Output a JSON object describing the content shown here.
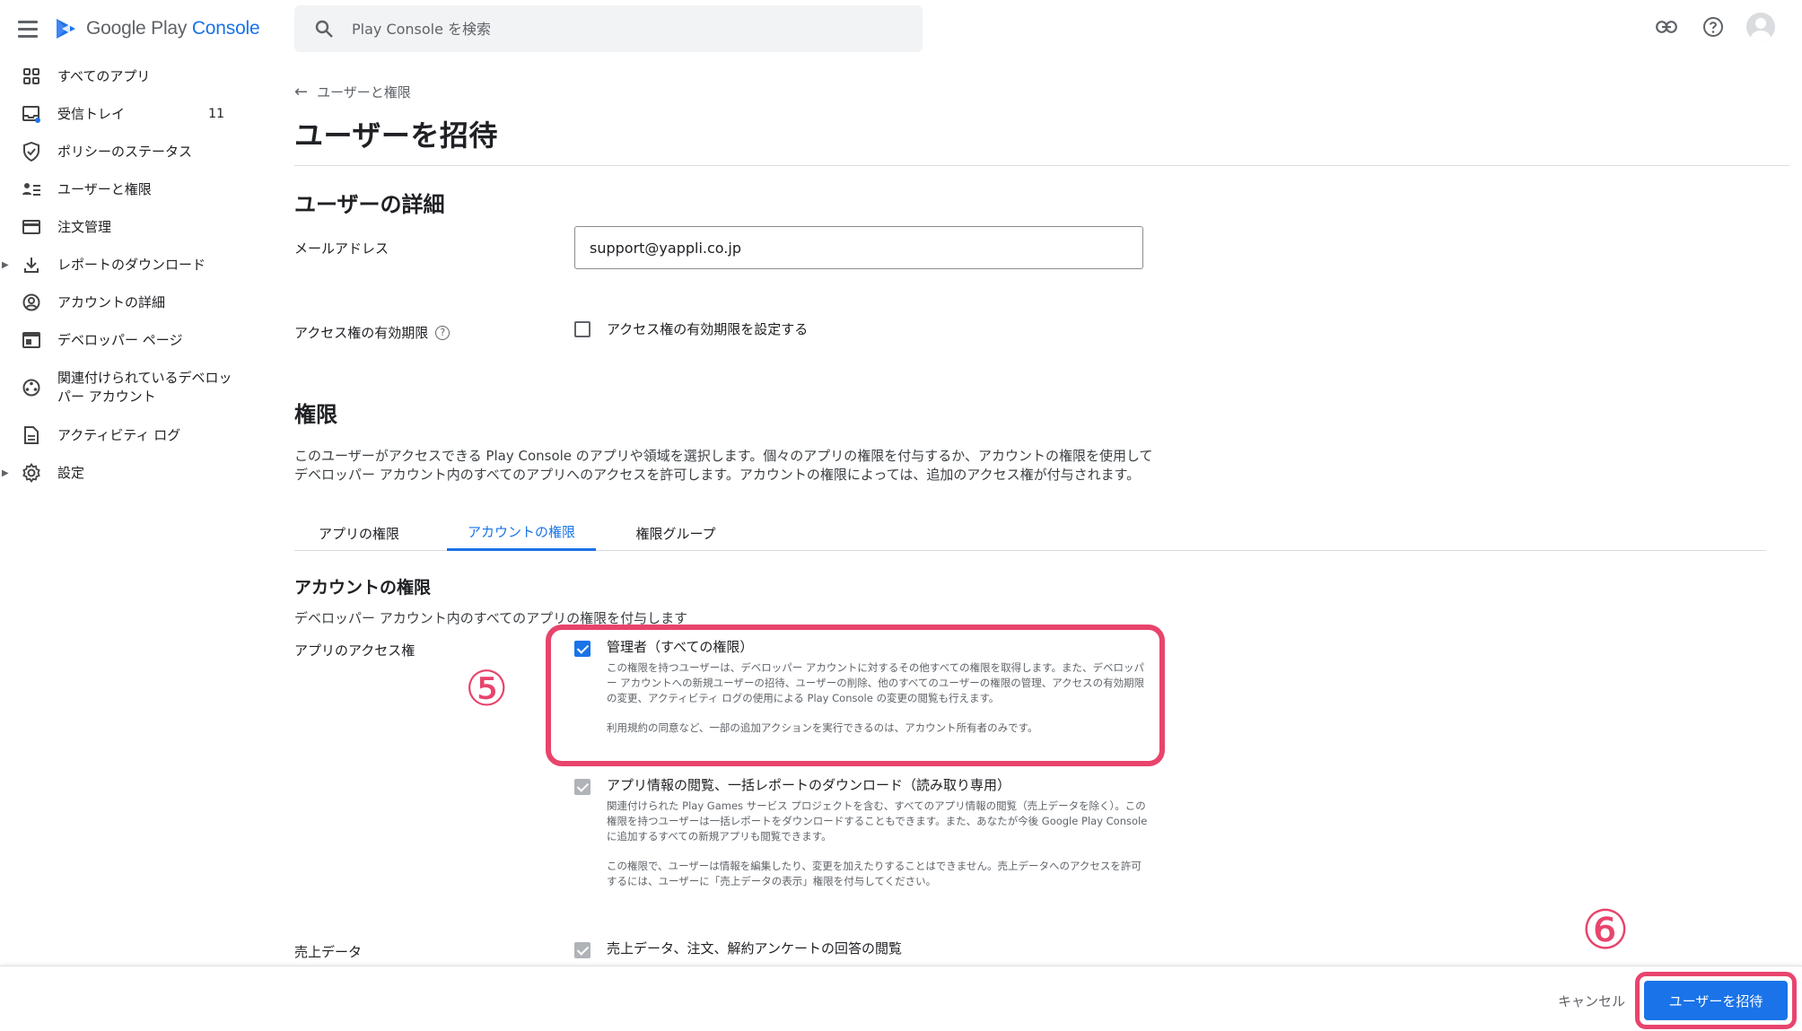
{
  "app": {
    "brand_prefix": "Google Play",
    "brand_suffix": "Console"
  },
  "search": {
    "placeholder": "Play Console を検索"
  },
  "sidebar": {
    "items": [
      {
        "label": "すべてのアプリ",
        "icon": "grid-icon"
      },
      {
        "label": "受信トレイ",
        "icon": "inbox-icon",
        "count": "11"
      },
      {
        "label": "ポリシーのステータス",
        "icon": "shield-icon"
      },
      {
        "label": "ユーザーと権限",
        "icon": "people-icon"
      },
      {
        "label": "注文管理",
        "icon": "credit-card-icon"
      },
      {
        "label": "レポートのダウンロード",
        "icon": "download-icon"
      },
      {
        "label": "アカウントの詳細",
        "icon": "account-circle-icon"
      },
      {
        "label": "デベロッパー ページ",
        "icon": "web-page-icon"
      },
      {
        "label": "関連付けられているデベロッパー アカウント",
        "icon": "linked-accounts-icon"
      },
      {
        "label": "アクティビティ ログ",
        "icon": "document-icon"
      },
      {
        "label": "設定",
        "icon": "gear-icon"
      }
    ]
  },
  "main": {
    "breadcrumb": "ユーザーと権限",
    "page_title": "ユーザーを招待",
    "user_details_title": "ユーザーの詳細",
    "email_label": "メールアドレス",
    "email_value": "support@yappli.co.jp",
    "expiry_label": "アクセス権の有効期限",
    "expiry_checkbox_label": "アクセス権の有効期限を設定する",
    "permissions_title": "権限",
    "permissions_desc": "このユーザーがアクセスできる Play Console のアプリや領域を選択します。個々のアプリの権限を付与するか、アカウントの権限を使用してデベロッパー アカウント内のすべてのアプリへのアクセスを許可します。アカウントの権限によっては、追加のアクセス権が付与されます。",
    "tabs": [
      {
        "label": "アプリの権限",
        "active": false
      },
      {
        "label": "アカウントの権限",
        "active": true
      },
      {
        "label": "権限グループ",
        "active": false
      }
    ],
    "account_perms_title": "アカウントの権限",
    "account_perms_desc": "デベロッパー アカウント内のすべてのアプリの権限を付与します",
    "app_access_label": "アプリのアクセス権",
    "admin": {
      "title": "管理者（すべての権限）",
      "desc": "この権限を持つユーザーは、デベロッパー アカウントに対するその他すべての権限を取得します。また、デベロッパー アカウントへの新規ユーザーの招待、ユーザーの削除、他のすべてのユーザーの権限の管理、アクセスの有効期限の変更、アクティビティ ログの使用による Play Console の変更の閲覧も行えます。",
      "note": "利用規約の同意など、一部の追加アクションを実行できるのは、アカウント所有者のみです。",
      "checked": true
    },
    "view_info": {
      "title": "アプリ情報の閲覧、一括レポートのダウンロード（読み取り専用）",
      "desc": "関連付けられた Play Games サービス プロジェクトを含む、すべてのアプリ情報の閲覧（売上データを除く）。この権限を持つユーザーは一括レポートをダウンロードすることもできます。また、あなたが今後 Google Play Console に追加するすべての新規アプリも閲覧できます。",
      "note": "この権限で、ユーザーは情報を編集したり、変更を加えたりすることはできません。売上データへのアクセスを許可するには、ユーザーに「売上データの表示」権限を付与してください。"
    },
    "sales_label": "売上データ",
    "sales": {
      "title": "売上データ、注文、解約アンケートの回答の閲覧"
    },
    "step5": "⑤",
    "step6": "⑥"
  },
  "footer": {
    "cancel_label": "キャンセル",
    "invite_label": "ユーザーを招待"
  },
  "colors": {
    "accent": "#1a73e8",
    "highlight": "#e8446c"
  }
}
